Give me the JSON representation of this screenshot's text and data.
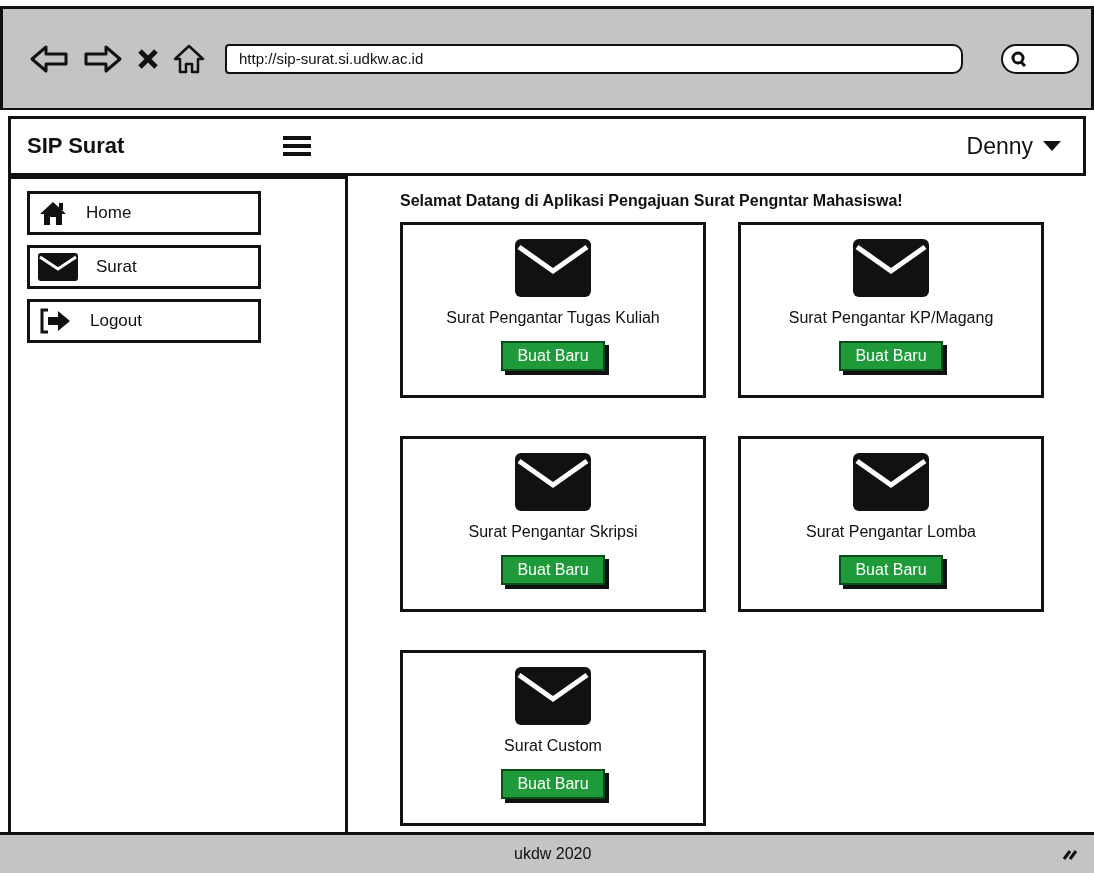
{
  "browser": {
    "url": "http://sip-surat.si.udkw.ac.id"
  },
  "navbar": {
    "brand": "SIP Surat",
    "user": "Denny"
  },
  "sidebar": {
    "items": [
      {
        "label": "Home",
        "kind": "home"
      },
      {
        "label": "Surat",
        "kind": "mail"
      },
      {
        "label": "Logout",
        "kind": "logout"
      }
    ]
  },
  "main": {
    "heading": "Selamat Datang di Aplikasi Pengajuan Surat Pengntar Mahasiswa!",
    "cards": [
      {
        "title": "Surat Pengantar Tugas Kuliah",
        "button": "Buat Baru"
      },
      {
        "title": "Surat Pengantar KP/Magang",
        "button": "Buat Baru"
      },
      {
        "title": "Surat Pengantar Skripsi",
        "button": "Buat Baru"
      },
      {
        "title": "Surat Pengantar Lomba",
        "button": "Buat Baru"
      },
      {
        "title": "Surat Custom",
        "button": "Buat Baru"
      }
    ]
  },
  "footer": {
    "text": "ukdw 2020"
  }
}
